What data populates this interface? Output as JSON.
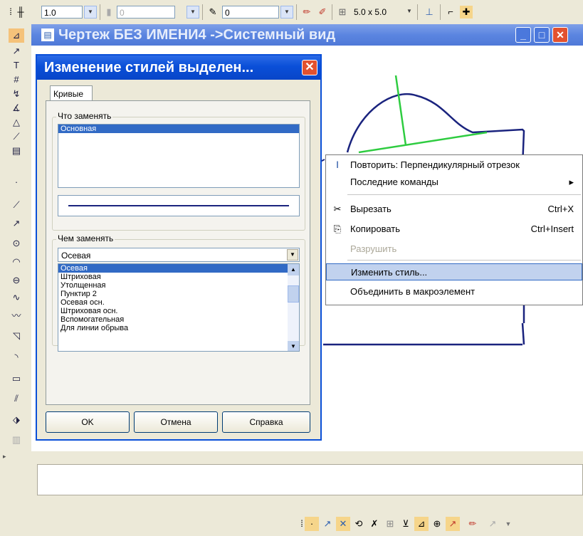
{
  "toolbar": {
    "scale_value": "1.0",
    "layer_value": "0",
    "style_value": "0",
    "grid_value": "5.0 x 5.0"
  },
  "window": {
    "title": "Чертеж БЕЗ ИМЕНИ4 ->Системный вид"
  },
  "dialog": {
    "title": "Изменение стилей выделен...",
    "tab_label": "Кривые",
    "replace_what_label": "Что заменять",
    "replace_what_items": [
      "Основная"
    ],
    "replace_with_label": "Чем заменять",
    "replace_with_value": "Осевая",
    "dropdown_options": [
      "Осевая",
      "Штриховая",
      "Утолщенная",
      "Пунктир 2",
      "Осевая осн.",
      "Штриховая осн.",
      "Вспомогательная",
      "Для линии обрыва"
    ],
    "ok_label": "OK",
    "cancel_label": "Отмена",
    "help_label": "Справка"
  },
  "context_menu": {
    "repeat_label": "Повторить: Перпендикулярный отрезок",
    "recent_label": "Последние команды",
    "cut_label": "Вырезать",
    "cut_shortcut": "Ctrl+X",
    "copy_label": "Копировать",
    "copy_shortcut": "Ctrl+Insert",
    "destroy_label": "Разрушить",
    "change_style_label": "Изменить стиль...",
    "merge_label": "Объединить в макроэлемент"
  },
  "colors": {
    "curve": "#1a237e",
    "perpendicular": "#2ecc40",
    "selection": "#316ac5",
    "menu_highlight": "#c1d2ee",
    "dialog_title": "#0a4fd8"
  }
}
